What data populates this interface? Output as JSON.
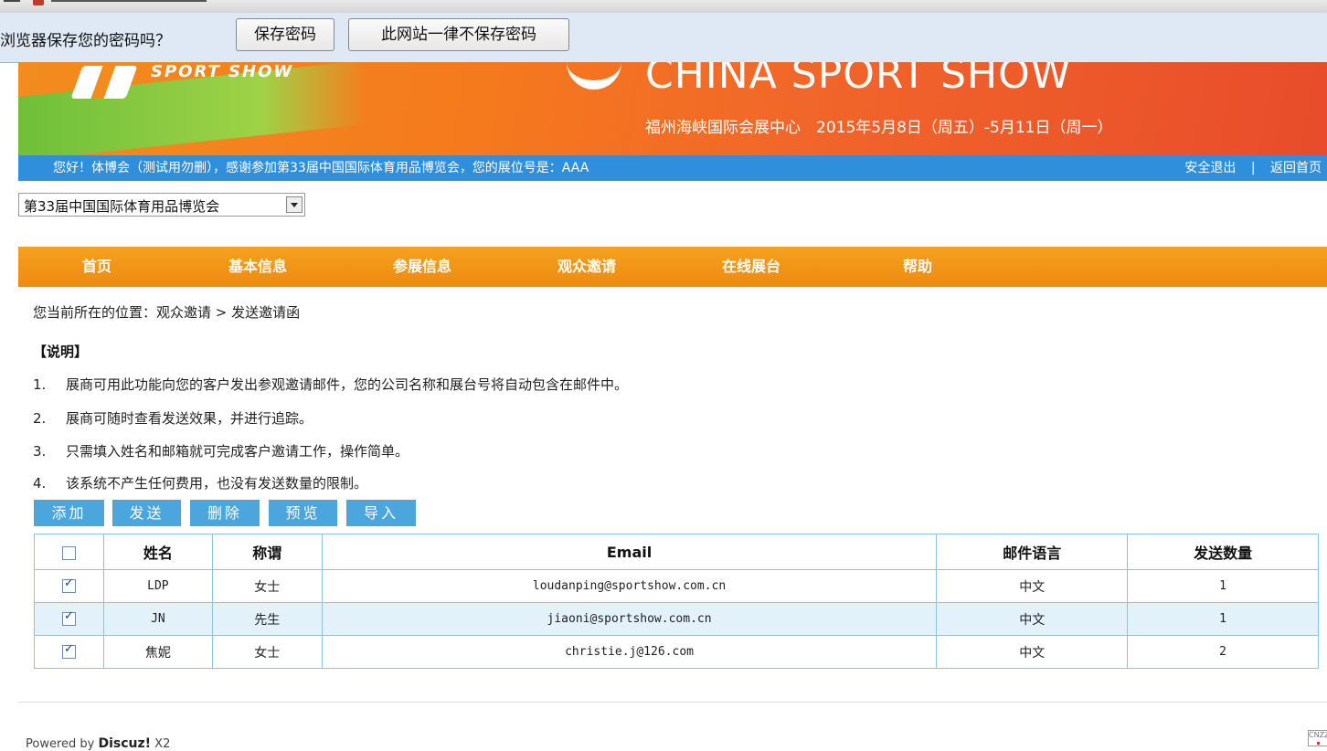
{
  "password_bar": {
    "question": "浏览器保存您的密码吗？",
    "save_label": "保存密码",
    "never_label": "此网站一律不保存密码"
  },
  "banner": {
    "logo_text": "SPORT SHOW",
    "title": "CHINA SPORT SHOW",
    "venue_dates": "福州海峡国际会展中心　2015年5月8日（周五）-5月11日（周一）"
  },
  "info_bar": {
    "greeting": "您好！体博会（测试用勿删），感谢参加第33届中国国际体育用品博览会，您的展位号是：AAA",
    "logout": "安全退出",
    "separator": "|",
    "home": "返回首页"
  },
  "expo_select": {
    "selected": "第33届中国国际体育用品博览会"
  },
  "nav": {
    "items": [
      "首页",
      "基本信息",
      "参展信息",
      "观众邀请",
      "在线展台",
      "帮助"
    ]
  },
  "breadcrumb": "您当前所在的位置：观众邀请 > 发送邀请函",
  "notes": {
    "title": "【说明】",
    "items": [
      {
        "num": "1.",
        "text": "展商可用此功能向您的客户发出参观邀请邮件，您的公司名称和展台号将自动包含在邮件中。"
      },
      {
        "num": "2.",
        "text": "展商可随时查看发送效果，并进行追踪。"
      },
      {
        "num": "3.",
        "text": "只需填入姓名和邮箱就可完成客户邀请工作，操作简单。"
      },
      {
        "num": "4.",
        "text": "该系统不产生任何费用，也没有发送数量的限制。"
      }
    ]
  },
  "actions": {
    "add": "添加",
    "send": "发送",
    "delete": "删除",
    "preview": "预览",
    "import": "导入"
  },
  "table": {
    "headers": [
      "姓名",
      "称谓",
      "Email",
      "邮件语言",
      "发送数量"
    ],
    "rows": [
      {
        "name": "LDP",
        "title": "女士",
        "email": "loudanping@sportshow.com.cn",
        "language": "中文",
        "count": "1",
        "checked": true
      },
      {
        "name": "JN",
        "title": "先生",
        "email": "jiaoni@sportshow.com.cn",
        "language": "中文",
        "count": "1",
        "checked": true
      },
      {
        "name": "焦妮",
        "title": "女士",
        "email": "christie.j@126.com",
        "language": "中文",
        "count": "2",
        "checked": true
      }
    ]
  },
  "footer": {
    "powered_prefix": "Powered by ",
    "powered_brand": "Discuz!",
    "powered_suffix": " X2",
    "badge": "CNZZ"
  },
  "colors": {
    "nav_orange": "#f5a11f",
    "info_blue": "#2f8fdd",
    "button_blue": "#4aa6dc",
    "row_highlight": "#e3f1fb"
  }
}
